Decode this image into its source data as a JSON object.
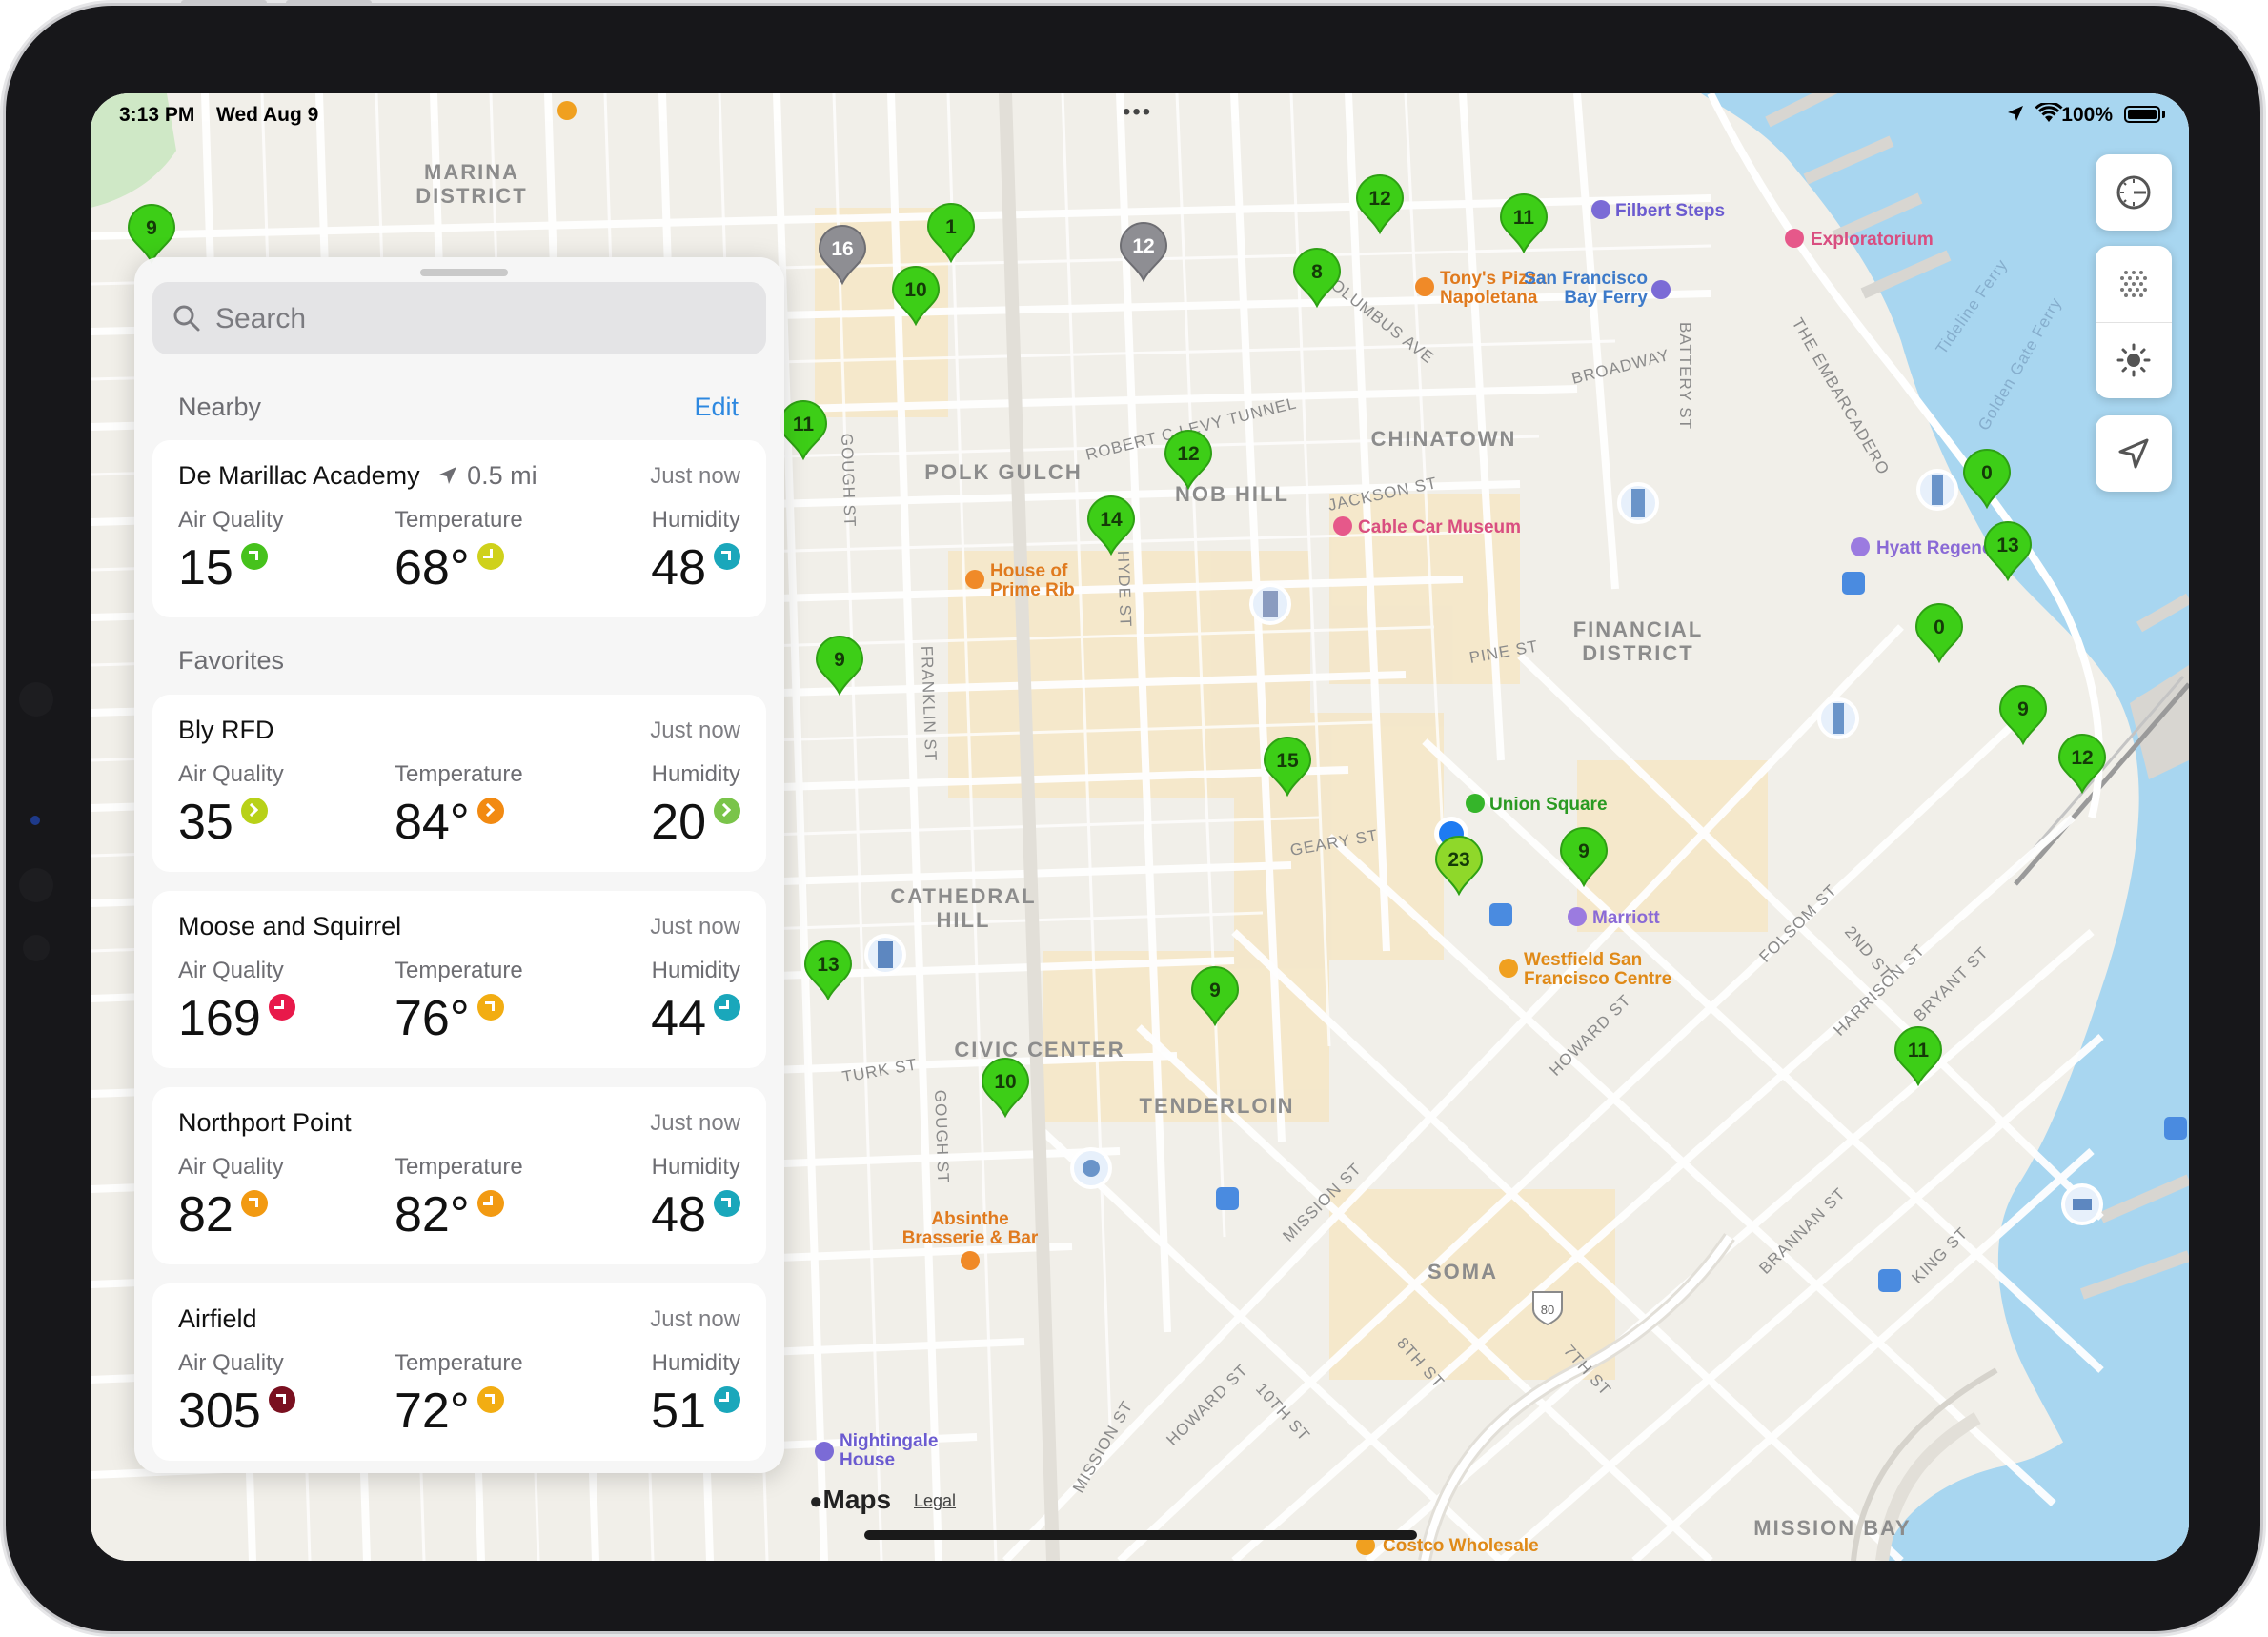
{
  "status_bar": {
    "time": "3:13 PM",
    "date": "Wed Aug 9",
    "battery": "100%",
    "multitask": "•••"
  },
  "search": {
    "placeholder": "Search"
  },
  "nearby": {
    "title": "Nearby",
    "edit_label": "Edit",
    "item": {
      "name": "De Marillac Academy",
      "distance": "0.5 mi",
      "updated": "Just now",
      "aq_label": "Air Quality",
      "aq": "15",
      "temp_label": "Temperature",
      "temp": "68°",
      "hum_label": "Humidity",
      "hum": "48"
    }
  },
  "favorites": {
    "title": "Favorites",
    "items": [
      {
        "name": "Bly RFD",
        "updated": "Just now",
        "aq_label": "Air Quality",
        "aq": "35",
        "temp_label": "Temperature",
        "temp": "84°",
        "hum_label": "Humidity",
        "hum": "20"
      },
      {
        "name": "Moose and Squirrel",
        "updated": "Just now",
        "aq_label": "Air Quality",
        "aq": "169",
        "temp_label": "Temperature",
        "temp": "76°",
        "hum_label": "Humidity",
        "hum": "44"
      },
      {
        "name": "Northport Point",
        "updated": "Just now",
        "aq_label": "Air Quality",
        "aq": "82",
        "temp_label": "Temperature",
        "temp": "82°",
        "hum_label": "Humidity",
        "hum": "48"
      },
      {
        "name": "Airfield",
        "updated": "Just now",
        "aq_label": "Air Quality",
        "aq": "305",
        "temp_label": "Temperature",
        "temp": "72°",
        "hum_label": "Humidity",
        "hum": "51"
      }
    ]
  },
  "colors": {
    "aq_green": "#46c21c",
    "aq_yellow": "#cfd11b",
    "aq_orange": "#f29a12",
    "aq_red": "#e8194a",
    "aq_maroon": "#7a1020",
    "teal": "#1aa7bb",
    "pin_green": "#3dce17",
    "pin_gray": "#8e8e93",
    "accent_blue": "#2d88e0"
  },
  "map": {
    "districts": [
      "MARINA DISTRICT",
      "POLK GULCH",
      "NOB HILL",
      "CHINATOWN",
      "FINANCIAL DISTRICT",
      "CATHEDRAL HILL",
      "CIVIC CENTER",
      "TENDERLOIN",
      "SOMA",
      "MISSION BAY"
    ],
    "streets": [
      "COLUMBUS AVE",
      "BROADWAY",
      "BATTERY ST",
      "THE EMBARCADERO",
      "ROBERT C LEVY TUNNEL",
      "JACKSON ST",
      "GOUGH ST",
      "HYDE ST",
      "FRANKLIN ST",
      "PINE ST",
      "GEARY ST",
      "TURK ST",
      "GOUGH ST",
      "MISSION ST",
      "HOWARD ST",
      "FOLSOM ST",
      "HARRISON ST",
      "BRYANT ST",
      "2ND ST",
      "BRANNAN ST",
      "KING ST",
      "8TH ST",
      "7TH ST",
      "10TH ST",
      "Tideline Ferry",
      "Golden Gate Ferry"
    ],
    "pois": [
      "Filbert Steps",
      "Exploratorium",
      "Tony's Pizza Napoletana",
      "San Francisco Bay Ferry",
      "Cable Car Museum",
      "House of Prime Rib",
      "Hyatt Regency",
      "Union Square",
      "Marriott",
      "Westfield San Francisco Centre",
      "Absinthe Brasserie & Bar",
      "Nightingale House",
      "Costco Wholesale"
    ],
    "pins": [
      "9",
      "16",
      "1",
      "12",
      "10",
      "12",
      "11",
      "8",
      "11",
      "12",
      "14",
      "0",
      "13",
      "9",
      "0",
      "15",
      "9",
      "12",
      "23",
      "9",
      "13",
      "9",
      "10",
      "11"
    ],
    "highway_shield": "80",
    "attribution": "Maps",
    "legal": "Legal"
  }
}
